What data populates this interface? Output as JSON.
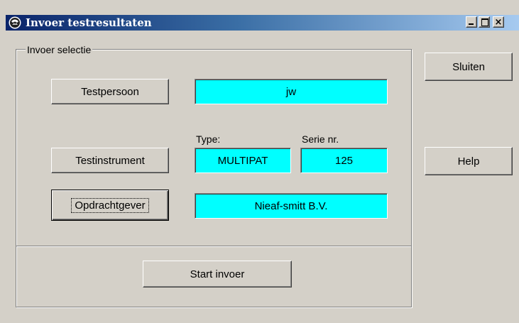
{
  "window": {
    "title": "Invoer testresultaten"
  },
  "group": {
    "legend": "Invoer selectie"
  },
  "buttons": {
    "testpersoon": "Testpersoon",
    "testinstrument": "Testinstrument",
    "opdrachtgever": "Opdrachtgever",
    "start_invoer": "Start invoer",
    "sluiten": "Sluiten",
    "help": "Help"
  },
  "labels": {
    "type": "Type:",
    "serie_nr": "Serie nr."
  },
  "fields": {
    "testpersoon": "jw",
    "type": "MULTIPAT",
    "serie_nr": "125",
    "opdrachtgever": "Nieaf-smitt B.V."
  },
  "colors": {
    "field_background": "#00ffff",
    "window_background": "#d4d0c8",
    "titlebar_start": "#0a246a",
    "titlebar_end": "#a6caf0"
  }
}
